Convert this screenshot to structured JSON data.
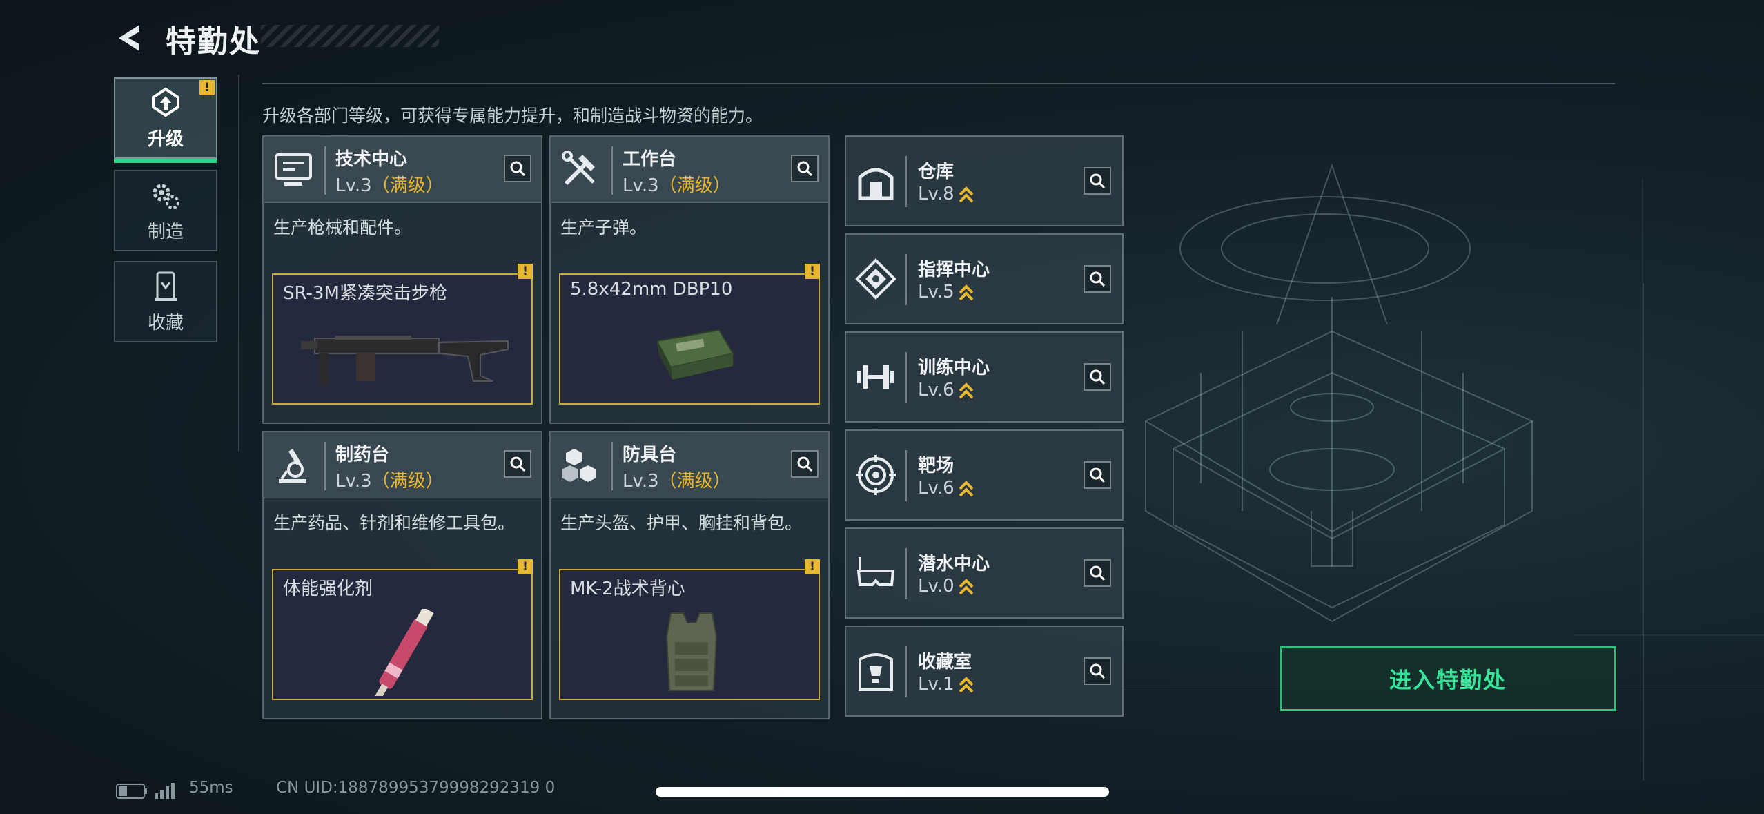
{
  "header": {
    "title": "特勤处",
    "back_icon": "back-arrow-icon"
  },
  "nav": [
    {
      "label": "升级",
      "icon": "upgrade-icon",
      "active": true,
      "alert": "!"
    },
    {
      "label": "制造",
      "icon": "gears-icon",
      "active": false
    },
    {
      "label": "收藏",
      "icon": "trophy-icon",
      "active": false
    }
  ],
  "description": "升级各部门等级，可获得专属能力提升，和制造战斗物资的能力。",
  "cards": [
    {
      "name": "技术中心",
      "level": "Lv.3",
      "max": "（满级）",
      "desc": "生产枪械和配件。",
      "product": "SR-3M紧凑突击步枪",
      "alert": "!",
      "icon": "monitor-icon"
    },
    {
      "name": "工作台",
      "level": "Lv.3",
      "max": "（满级）",
      "desc": "生产子弹。",
      "product": "5.8x42mm DBP10",
      "alert": "!",
      "icon": "tools-icon"
    },
    {
      "name": "制药台",
      "level": "Lv.3",
      "max": "（满级）",
      "desc": "生产药品、针剂和维修工具包。",
      "product": "体能强化剂",
      "alert": "!",
      "icon": "microscope-icon"
    },
    {
      "name": "防具台",
      "level": "Lv.3",
      "max": "（满级）",
      "desc": "生产头盔、护甲、胸挂和背包。",
      "product": "MK-2战术背心",
      "alert": "!",
      "icon": "cubes-icon"
    }
  ],
  "facilities": [
    {
      "name": "仓库",
      "level": "Lv.8",
      "icon": "warehouse-icon"
    },
    {
      "name": "指挥中心",
      "level": "Lv.5",
      "icon": "command-icon"
    },
    {
      "name": "训练中心",
      "level": "Lv.6",
      "icon": "dumbbell-icon"
    },
    {
      "name": "靶场",
      "level": "Lv.6",
      "icon": "target-icon"
    },
    {
      "name": "潜水中心",
      "level": "Lv.0",
      "icon": "diving-mask-icon"
    },
    {
      "name": "收藏室",
      "level": "Lv.1",
      "icon": "trophy-icon"
    }
  ],
  "enter_button": "进入特勤处",
  "status": {
    "ping": "55ms",
    "uid": "CN UID:18878995379998292319 0"
  },
  "colors": {
    "accent_green": "#2fd38b",
    "max_gold": "#e8b730",
    "product_border": "#c9a845"
  }
}
